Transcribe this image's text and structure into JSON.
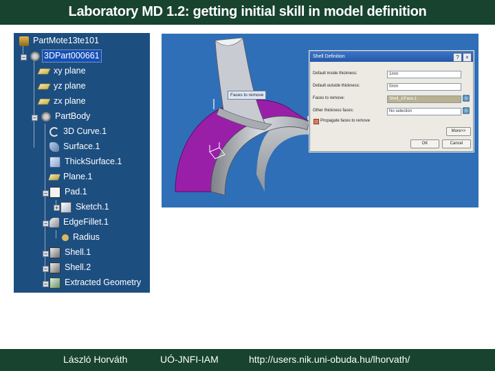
{
  "slide": {
    "title": "Laboratory MD 1.2: getting initial skill in model definition",
    "footer": {
      "author": "László Horváth",
      "institute": "UÓ-JNFI-IAM",
      "url": "http://users.nik.uni-obuda.hu/lhorvath/"
    }
  },
  "tree": {
    "items": [
      {
        "label": "PartMote13te101",
        "icon": "part-file-icon"
      },
      {
        "label": "3DPart000661",
        "icon": "gear-icon",
        "selected": true
      },
      {
        "label": "xy plane",
        "icon": "plane-icon"
      },
      {
        "label": "yz plane",
        "icon": "plane-icon"
      },
      {
        "label": "zx plane",
        "icon": "plane-icon"
      },
      {
        "label": "PartBody",
        "icon": "gear-icon"
      },
      {
        "label": "3D Curve.1",
        "icon": "curve-icon"
      },
      {
        "label": "Surface.1",
        "icon": "surface-icon"
      },
      {
        "label": "ThickSurface.1",
        "icon": "thick-surface-icon"
      },
      {
        "label": "Plane.1",
        "icon": "plane-feature-icon"
      },
      {
        "label": "Pad.1",
        "icon": "pad-icon"
      },
      {
        "label": "Sketch.1",
        "icon": "sketch-icon"
      },
      {
        "label": "EdgeFillet.1",
        "icon": "fillet-icon"
      },
      {
        "label": "Radius",
        "icon": "radius-icon"
      },
      {
        "label": "Shell.1",
        "icon": "shell-icon"
      },
      {
        "label": "Shell.2",
        "icon": "shell-icon"
      },
      {
        "label": "Extracted Geometry",
        "icon": "extract-icon"
      }
    ]
  },
  "viewer": {
    "tooltip": "Faces to remove",
    "colors": {
      "background": "#2f6fb7",
      "arch_face": "#9a1fa8",
      "model": "#b8bcc2"
    }
  },
  "dialog": {
    "title": "Shell Definition",
    "rows": [
      {
        "label": "Default inside thickness:",
        "value": "1mm"
      },
      {
        "label": "Default outside thickness:",
        "value": "0mm"
      },
      {
        "label": "Faces to remove:",
        "value": "Shell_1\\Face.1",
        "highlight": true
      },
      {
        "label": "Other thickness faces:",
        "value": "No selection"
      }
    ],
    "checkbox_label": "Propagate faces to remove",
    "more_button": "More>>",
    "ok_button": "OK",
    "cancel_button": "Cancel"
  }
}
